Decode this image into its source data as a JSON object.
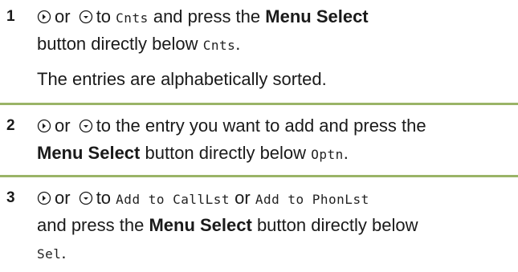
{
  "steps": [
    {
      "number": "1",
      "line1": {
        "connector": "or",
        "pre": "to",
        "code": "Cnts",
        "mid": "and press the",
        "bold": "Menu Select"
      },
      "line2": {
        "pre": "button directly below",
        "code": "Cnts",
        "post": "."
      },
      "note": "The entries are alphabetically sorted."
    },
    {
      "number": "2",
      "line1": {
        "connector": "or",
        "text": "to the entry you want to add and press the"
      },
      "line2": {
        "bold": "Menu Select",
        "pre": "button directly below",
        "code": "Optn",
        "post": "."
      }
    },
    {
      "number": "3",
      "line1": {
        "connector": "or",
        "pre": "to",
        "code_a": "Add to CallLst",
        "mid": "or",
        "code_b": "Add to PhonLst"
      },
      "line2": {
        "pre": "and press the",
        "bold": "Menu Select",
        "post": "button directly below"
      },
      "line3": {
        "code": "Sel",
        "post": "."
      }
    }
  ],
  "icons": {
    "right": "nav-right-icon",
    "left": "nav-left-icon"
  },
  "colors": {
    "rule": "#9ab467"
  }
}
